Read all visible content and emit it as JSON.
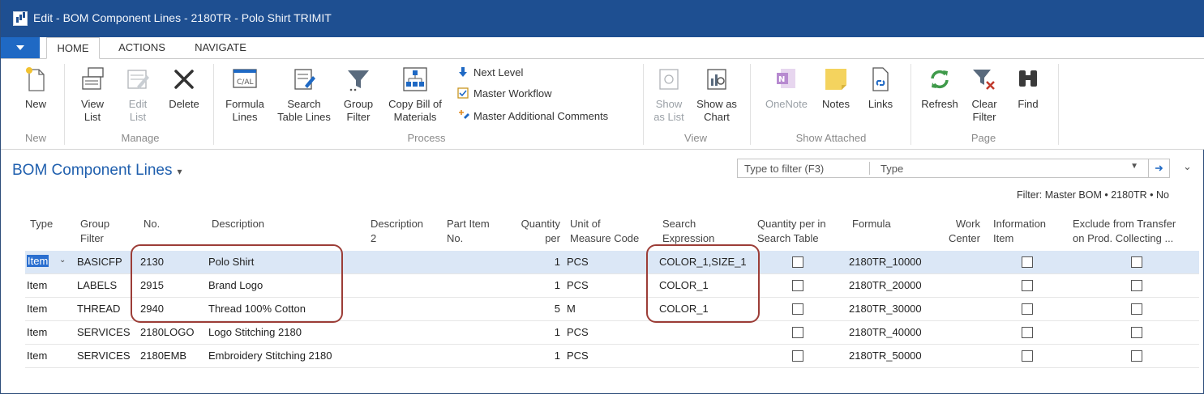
{
  "window": {
    "title": "Edit - BOM Component Lines - 2180TR - Polo Shirt TRIMIT"
  },
  "ribbon_tabs": [
    "HOME",
    "ACTIONS",
    "NAVIGATE"
  ],
  "ribbon": {
    "new": "New",
    "view_list": "View\nList",
    "edit_list": "Edit\nList",
    "delete": "Delete",
    "formula_lines": "Formula\nLines",
    "search_table_lines": "Search\nTable Lines",
    "group_filter": "Group\nFilter",
    "copy_bom": "Copy Bill of\nMaterials",
    "next_level": "Next Level",
    "master_workflow": "Master Workflow",
    "master_additional_comments": "Master Additional Comments",
    "show_as_list": "Show\nas List",
    "show_as_chart": "Show as\nChart",
    "onenote": "OneNote",
    "notes": "Notes",
    "links": "Links",
    "refresh": "Refresh",
    "clear_filter": "Clear\nFilter",
    "find": "Find",
    "groups": {
      "new": "New",
      "manage": "Manage",
      "process": "Process",
      "view": "View",
      "show_attached": "Show Attached",
      "page": "Page"
    }
  },
  "list": {
    "title": "BOM Component Lines",
    "filter_placeholder": "Type to filter (F3)",
    "filter_field": "Type",
    "filter_summary": "Filter: Master BOM • 2180TR • No"
  },
  "columns": {
    "type": "Type",
    "group_filter": "Group\nFilter",
    "no": "No.",
    "description": "Description",
    "description2": "Description\n2",
    "part_item_no": "Part Item\nNo.",
    "quantity_per": "Quantity\nper",
    "uom": "Unit of\nMeasure Code",
    "search_expression": "Search\nExpression",
    "qty_per_search": "Quantity per in\nSearch Table",
    "formula": "Formula",
    "work_center": "Work\nCenter",
    "information_item": "Information\nItem",
    "exclude": "Exclude from Transfer\non Prod. Collecting ..."
  },
  "rows": [
    {
      "type": "Item",
      "group_filter": "BASICFP",
      "no": "2130",
      "description": "Polo Shirt",
      "quantity": "1",
      "uom": "PCS",
      "search_expression": "COLOR_1,SIZE_1",
      "formula": "2180TR_10000"
    },
    {
      "type": "Item",
      "group_filter": "LABELS",
      "no": "2915",
      "description": "Brand Logo",
      "quantity": "1",
      "uom": "PCS",
      "search_expression": "COLOR_1",
      "formula": "2180TR_20000"
    },
    {
      "type": "Item",
      "group_filter": "THREAD",
      "no": "2940",
      "description": "Thread 100% Cotton",
      "quantity": "5",
      "uom": "M",
      "search_expression": "COLOR_1",
      "formula": "2180TR_30000"
    },
    {
      "type": "Item",
      "group_filter": "SERVICES",
      "no": "2180LOGO",
      "description": "Logo Stitching 2180",
      "quantity": "1",
      "uom": "PCS",
      "search_expression": "",
      "formula": "2180TR_40000"
    },
    {
      "type": "Item",
      "group_filter": "SERVICES",
      "no": "2180EMB",
      "description": "Embroidery Stitching 2180",
      "quantity": "1",
      "uom": "PCS",
      "search_expression": "",
      "formula": "2180TR_50000"
    }
  ],
  "colors": {
    "titlebar": "#1e4f91",
    "accent": "#1f69c4",
    "highlight": "#9c3d37",
    "selected_row": "#dbe7f6"
  }
}
